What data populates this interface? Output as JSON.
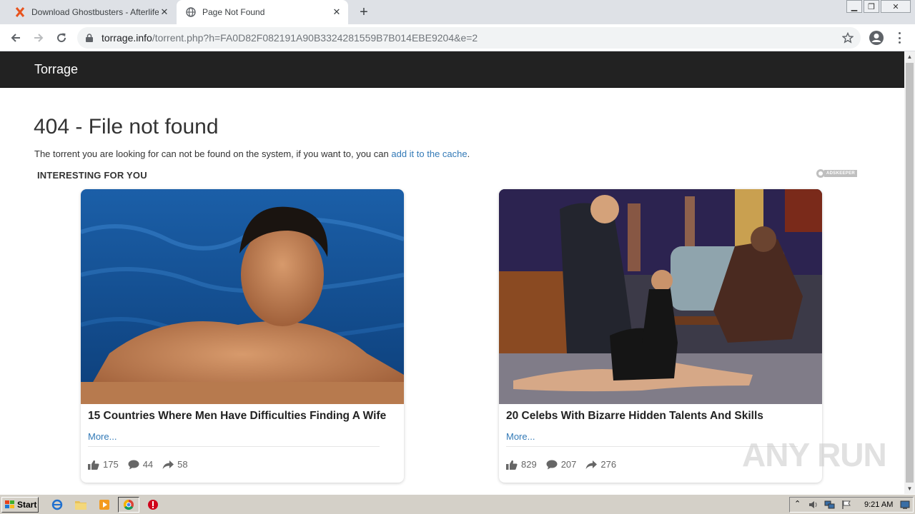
{
  "browser": {
    "tabs": [
      {
        "title": "Download Ghostbusters - Afterlife (2",
        "active": false
      },
      {
        "title": "Page Not Found",
        "active": true
      }
    ],
    "url_domain": "torrage.info",
    "url_path": "/torrent.php?h=FA0D82F082191A90B3324281559B7B014EBE9204&e=2"
  },
  "site": {
    "brand": "Torrage",
    "heading": "404 - File not found",
    "lead_text": "The torrent you are looking for can not be found on the system, if you want to, you can ",
    "lead_link": "add it to the cache",
    "lead_end": ".",
    "section_title": "INTERESTING FOR YOU",
    "ad_network": "ADSKEEPER"
  },
  "cards": [
    {
      "title": "15 Countries Where Men Have Difficulties Finding A Wife",
      "more": "More...",
      "likes": "175",
      "comments": "44",
      "shares": "58"
    },
    {
      "title": "20 Celebs With Bizarre Hidden Talents And Skills",
      "more": "More...",
      "likes": "829",
      "comments": "207",
      "shares": "276"
    }
  ],
  "watermark": "ANY RUN",
  "taskbar": {
    "start": "Start",
    "clock": "9:21 AM"
  },
  "colors": {
    "navbar": "#222222",
    "link": "#337ab7",
    "tabstrip": "#dee1e6"
  }
}
